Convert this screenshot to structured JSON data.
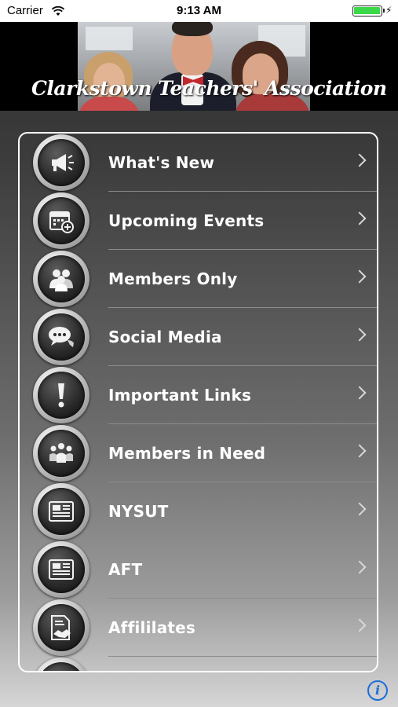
{
  "status_bar": {
    "carrier": "Carrier",
    "time": "9:13 AM"
  },
  "header": {
    "title": "Clarkstown Teachers' Association"
  },
  "menu": {
    "items": [
      {
        "label": "What's New",
        "icon": "megaphone-icon"
      },
      {
        "label": "Upcoming Events",
        "icon": "calendar-add-icon"
      },
      {
        "label": "Members Only",
        "icon": "members-icon"
      },
      {
        "label": "Social Media",
        "icon": "chat-bubbles-icon"
      },
      {
        "label": "Important Links",
        "icon": "exclamation-icon"
      },
      {
        "label": "Members in Need",
        "icon": "group-support-icon"
      },
      {
        "label": "NYSUT",
        "icon": "newspaper-icon"
      },
      {
        "label": "AFT",
        "icon": "newspaper-icon"
      },
      {
        "label": "Affililates",
        "icon": "document-handshake-icon"
      },
      {
        "label": "",
        "icon": "partial-icon"
      }
    ]
  },
  "colors": {
    "menu_border": "#ffffff",
    "info_accent": "#1b6ddc",
    "battery": "#3bd84a"
  }
}
